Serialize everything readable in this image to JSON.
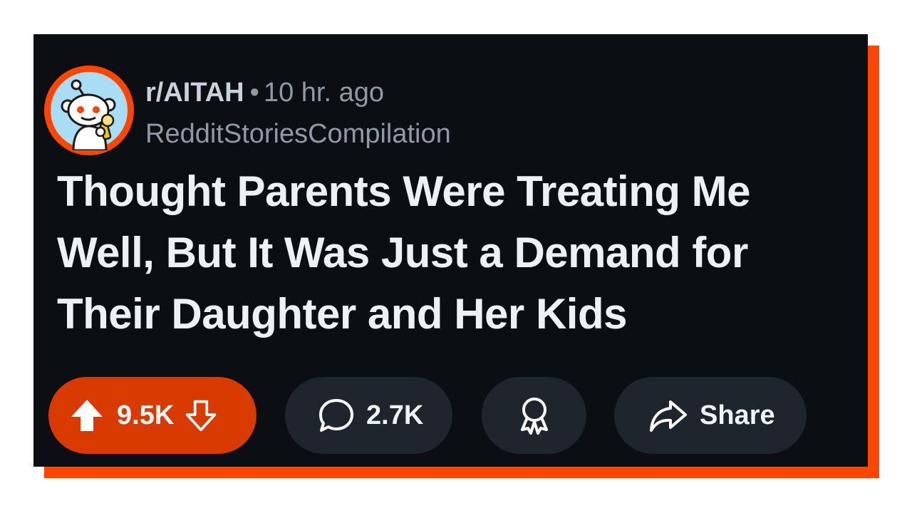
{
  "post": {
    "subreddit": "r/AITAH",
    "separator": "•",
    "time_ago": "10 hr. ago",
    "author": "RedditStoriesCompilation",
    "title": "Thought Parents Were Treating Me Well, But It Was Just a Demand for Their Daughter and Her Kids"
  },
  "actions": {
    "upvotes": "9.5K",
    "comments": "2.7K",
    "share_label": "Share"
  },
  "icons": {
    "avatar": "reddit-snoo-microphone-icon",
    "upvote": "arrow-up-icon",
    "downvote": "arrow-down-icon",
    "comment": "speech-bubble-icon",
    "award": "award-ribbon-icon",
    "share": "share-arrow-icon"
  },
  "colors": {
    "accent": "#ff4500",
    "card_background": "#0b0e12",
    "vote_pill": "#d93a00",
    "pill": "#1f252c",
    "title_text": "#edf1f4",
    "muted_text": "#8e9aa5"
  }
}
